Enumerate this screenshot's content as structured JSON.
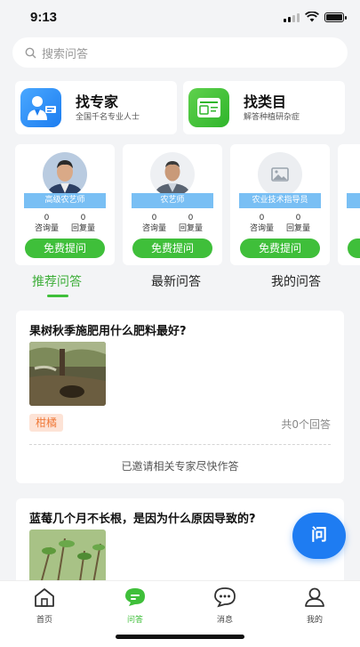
{
  "status": {
    "time": "9:13"
  },
  "search": {
    "placeholder": "搜索问答"
  },
  "features": [
    {
      "title": "找专家",
      "subtitle": "全国千名专业人士"
    },
    {
      "title": "找类目",
      "subtitle": "解答种植研杂症"
    }
  ],
  "experts": [
    {
      "role": "高级农艺师",
      "consult_count": "0",
      "consult_label": "咨询量",
      "reply_count": "0",
      "reply_label": "回复量",
      "ask_label": "免费提问"
    },
    {
      "role": "农艺师",
      "consult_count": "0",
      "consult_label": "咨询量",
      "reply_count": "0",
      "reply_label": "回复量",
      "ask_label": "免费提问"
    },
    {
      "role": "农业技术指导员",
      "consult_count": "0",
      "consult_label": "咨询量",
      "reply_count": "0",
      "reply_label": "回复量",
      "ask_label": "免费提问"
    }
  ],
  "tabs": [
    {
      "label": "推荐问答",
      "active": true
    },
    {
      "label": "最新问答",
      "active": false
    },
    {
      "label": "我的问答",
      "active": false
    }
  ],
  "questions": [
    {
      "title": "果树秋季施肥用什么肥料最好?",
      "tag": "柑橘",
      "answer_count": "共0个回答",
      "invited_text": "已邀请相关专家尽快作答"
    },
    {
      "title": "蓝莓几个月不长根，是因为什么原因导致的?"
    }
  ],
  "fab": {
    "label": "问"
  },
  "nav": [
    {
      "label": "首页",
      "icon": "home-icon"
    },
    {
      "label": "问答",
      "icon": "chat-icon"
    },
    {
      "label": "消息",
      "icon": "message-icon"
    },
    {
      "label": "我的",
      "icon": "user-icon"
    }
  ],
  "colors": {
    "accent_green": "#3fbf3a",
    "badge_blue": "#79bff4",
    "fab_blue": "#1e7cf2",
    "tag_orange": "#f07a3a"
  }
}
